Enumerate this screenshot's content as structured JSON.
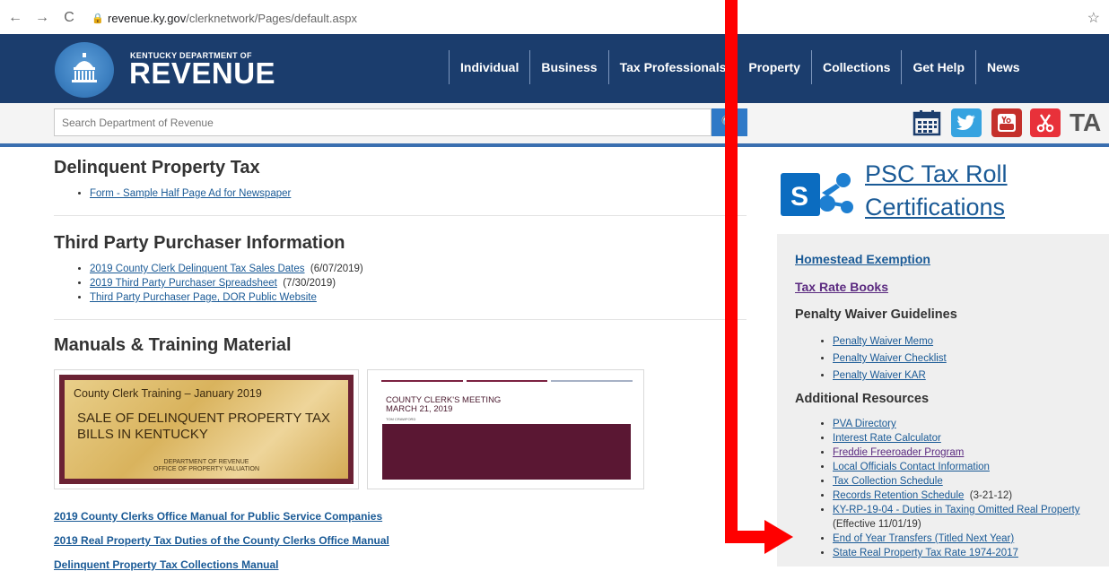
{
  "browser": {
    "url_host": "revenue.ky.gov",
    "url_path": "/clerknetwork/Pages/default.aspx"
  },
  "header": {
    "logo_small": "KENTUCKY DEPARTMENT OF",
    "logo_big": "REVENUE",
    "nav": [
      "Individual",
      "Business",
      "Tax Professionals",
      "Property",
      "Collections",
      "Get Help",
      "News"
    ]
  },
  "search": {
    "placeholder": "Search Department of Revenue"
  },
  "social": {
    "ta_text": "TA"
  },
  "main": {
    "delinquent_title": "Delinquent Property Tax",
    "delinquent_links": [
      {
        "text": "Form - Sample Half Page Ad for Newspaper",
        "note": ""
      }
    ],
    "third_party_title": "Third Party Purchaser Information",
    "third_party_links": [
      {
        "text": "2019 County Clerk Delinquent Tax Sales Dates",
        "note": "(6/07/2019)"
      },
      {
        "text": "2019 Third Party Purchaser Spreadsheet",
        "note": "(7/30/2019)"
      },
      {
        "text": "Third Party Purchaser Page, DOR Public Website",
        "note": ""
      }
    ],
    "manuals_title": "Manuals & Training Material",
    "thumb1": {
      "line1": "County Clerk Training – January 2019",
      "line2": "SALE OF DELINQUENT PROPERTY TAX BILLS IN KENTUCKY",
      "line3a": "DEPARTMENT OF REVENUE",
      "line3b": "OFFICE OF PROPERTY VALUATION"
    },
    "thumb2": {
      "line1": "COUNTY CLERK'S MEETING",
      "line2": "MARCH 21, 2019",
      "byline": "TOM CRAWFORD"
    },
    "manual_links": [
      "2019 County Clerks Office Manual for Public Service Companies",
      "2019 Real Property Tax Duties of the County Clerks Office Manual",
      "Delinquent Property Tax Collections Manual"
    ]
  },
  "sidebar": {
    "psc_title_line1": "PSC Tax Roll",
    "psc_title_line2": "Certifications",
    "homestead": "Homestead Exemption",
    "tax_rate_books": "Tax Rate Books",
    "penalty_title": "Penalty Waiver Guidelines",
    "penalty_links": [
      "Penalty Waiver Memo",
      "Penalty Waiver Checklist",
      "Penalty Waiver KAR"
    ],
    "additional_title": "Additional Resources",
    "additional_links": [
      {
        "text": "PVA Directory",
        "note": ""
      },
      {
        "text": "Interest Rate Calculator",
        "note": ""
      },
      {
        "text": "Freddie Freeroader Program",
        "note": ""
      },
      {
        "text": "Local Officials Contact Information",
        "note": ""
      },
      {
        "text": "Tax Collection Schedule",
        "note": ""
      },
      {
        "text": "Records Retention Schedule",
        "note": "(3-21-12)"
      },
      {
        "text": "KY-RP-19-04 - Duties in Taxing Omitted Real Property",
        "note": "(Effective 11/01/19)"
      },
      {
        "text": "End of Year Transfers (Titled Next Year)",
        "note": ""
      },
      {
        "text": "State Real Property Tax Rate 1974-2017",
        "note": ""
      }
    ]
  },
  "colors": {
    "header_bg": "#1b3d6d",
    "link": "#1a5a96",
    "annotation": "#ff0000"
  }
}
